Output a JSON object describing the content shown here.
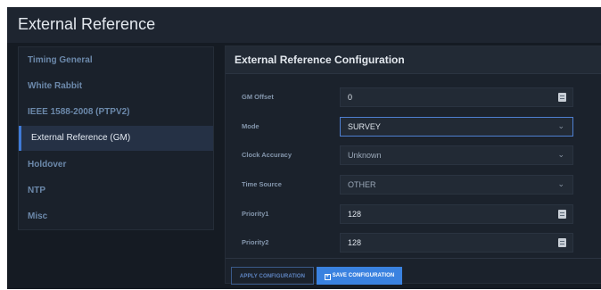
{
  "window": {
    "title": "External Reference"
  },
  "sidebar": {
    "items": [
      {
        "label": "Timing General"
      },
      {
        "label": "White Rabbit"
      },
      {
        "label": "IEEE 1588-2008 (PTPV2)"
      },
      {
        "label": "External Reference (GM)",
        "active": true
      },
      {
        "label": "Holdover"
      },
      {
        "label": "NTP"
      },
      {
        "label": "Misc"
      }
    ]
  },
  "main": {
    "title": "External Reference Configuration",
    "fields": [
      {
        "label": "GM Offset",
        "value": "0",
        "control": "number"
      },
      {
        "label": "Mode",
        "value": "SURVEY",
        "control": "select",
        "focused": true
      },
      {
        "label": "Clock Accuracy",
        "value": "Unknown",
        "control": "select"
      },
      {
        "label": "Time Source",
        "value": "OTHER",
        "control": "select"
      },
      {
        "label": "Priority1",
        "value": "128",
        "control": "number"
      },
      {
        "label": "Priority2",
        "value": "128",
        "control": "number"
      }
    ]
  },
  "actions": {
    "apply_label": "APPLY CONFIGURATION",
    "save_label": "SAVE CONFIGURATION",
    "save_icon": "save-icon"
  },
  "colors": {
    "accent": "#3a82e0",
    "background": "#151b23",
    "active_item": "#253145"
  }
}
